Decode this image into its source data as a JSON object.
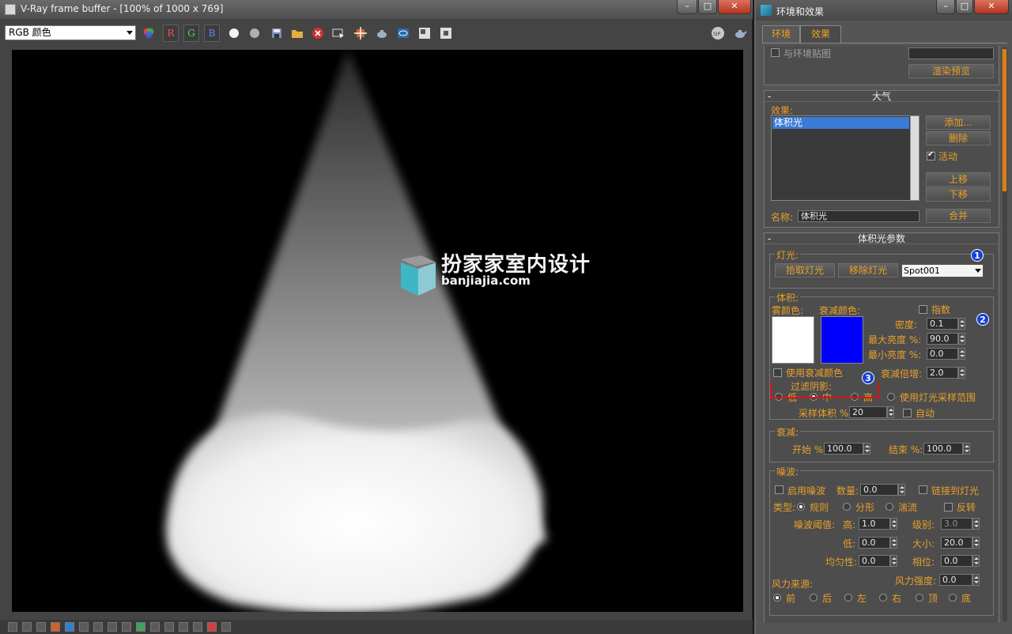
{
  "vfb": {
    "title": "V-Ray frame buffer - [100% of 1000 x 769]",
    "channel": "RGB 颜色",
    "buttons": {
      "r": "R",
      "g": "G",
      "b": "B"
    },
    "watermark": {
      "title": "扮家家室内设计",
      "subtitle": "banjiajia.com"
    },
    "toolbar_icons": [
      "color-wheel-icon",
      "white-circle-icon",
      "grey-circle-icon",
      "save-icon",
      "open-folder-icon",
      "clear-icon",
      "track-mouse-icon",
      "region-render-icon",
      "teapot-render-icon",
      "link-viewport-icon",
      "compare-a-icon",
      "compare-b-icon",
      "stamp-icon",
      "teapot-icon"
    ]
  },
  "env": {
    "title": "环境和效果",
    "tabs": [
      "环境",
      "效果"
    ],
    "top": {
      "env_map_label": "与环境贴图",
      "render_preview": "渲染预览"
    },
    "atmosphere": {
      "header": "大气",
      "effects_label": "效果:",
      "effects_list": [
        "体积光"
      ],
      "add": "添加...",
      "delete": "删除",
      "active": "活动",
      "move_up": "上移",
      "move_down": "下移",
      "name_label": "名称:",
      "name_value": "体积光",
      "merge": "合并"
    },
    "volume_light": {
      "header": "体积光参数",
      "lights_group": "灯光:",
      "pick_light": "拾取灯光",
      "remove_light": "移除灯光",
      "light_name": "Spot001",
      "volume_group": "体积:",
      "fog_color": "雾颜色:",
      "attenuation_color": "衰减颜色:",
      "fog_color_hex": "#ffffff",
      "attenuation_color_hex": "#0000ff",
      "exponential": "指数",
      "density_label": "密度:",
      "density": "0.1",
      "max_light_label": "最大亮度 %:",
      "max_light": "90.0",
      "min_light_label": "最小亮度 %:",
      "min_light": "0.0",
      "use_atten_color": "使用衰减颜色",
      "atten_mult_label": "衰减倍增:",
      "atten_mult": "2.0",
      "filter_shadows": "过滤阴影:",
      "low": "低",
      "medium": "中",
      "high": "高",
      "use_light_smp": "使用灯光采样范围",
      "sample_volume_label": "采样体积 %:",
      "sample_volume": "20",
      "auto": "自动",
      "decay_group": "衰减:",
      "start_label": "开始 %:",
      "start": "100.0",
      "end_label": "结束 %:",
      "end": "100.0",
      "noise_group": "噪波:",
      "noise_on": "启用噪波",
      "amount_label": "数量:",
      "amount": "0.0",
      "link_to_light": "链接到灯光",
      "type_label": "类型:",
      "regular": "规则",
      "fractal": "分形",
      "turbulence": "湍流",
      "invert": "反转",
      "noise_threshold": "噪波阈值:",
      "high_label": "高:",
      "high_value": "1.0",
      "levels_label": "级别:",
      "levels": "3.0",
      "low_label": "低:",
      "low_value": "0.0",
      "size_label": "大小:",
      "size": "20.0",
      "uniformity_label": "均匀性:",
      "uniformity": "0.0",
      "phase_label": "相位:",
      "phase": "0.0",
      "wind_from": "风力来源:",
      "wind_strength_label": "风力强度:",
      "wind_strength": "0.0",
      "wind_dirs": [
        "前",
        "后",
        "左",
        "右",
        "顶",
        "底"
      ]
    },
    "callouts": [
      "1",
      "2",
      "3"
    ]
  },
  "colors": {
    "accent_label": "#e8a02a",
    "selection": "#3a7bd5",
    "callout": "#1540d8",
    "red_mark": "#e01010"
  }
}
